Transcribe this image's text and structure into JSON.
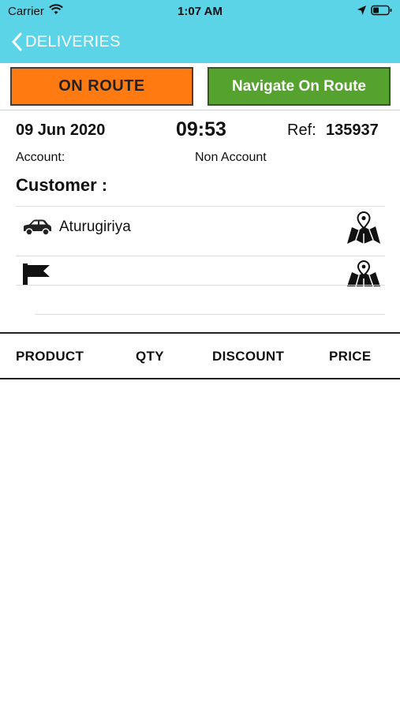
{
  "status_bar": {
    "carrier": "Carrier",
    "time": "1:07 AM"
  },
  "nav": {
    "back_label": "DELIVERIES"
  },
  "buttons": {
    "on_route": "ON ROUTE",
    "navigate": "Navigate On Route"
  },
  "order": {
    "date": "09 Jun 2020",
    "time": "09:53",
    "ref_label": "Ref:",
    "ref_value": "135937",
    "account_label": "Account:",
    "account_value": "Non Account",
    "customer_label": "Customer :",
    "pickup_location": "Aturugiriya",
    "destination_location": ""
  },
  "table": {
    "columns": [
      "PRODUCT",
      "QTY",
      "DISCOUNT",
      "PRICE"
    ]
  },
  "colors": {
    "header": "#5bd4e8",
    "on_route": "#ff7a10",
    "navigate": "#55a22f"
  }
}
